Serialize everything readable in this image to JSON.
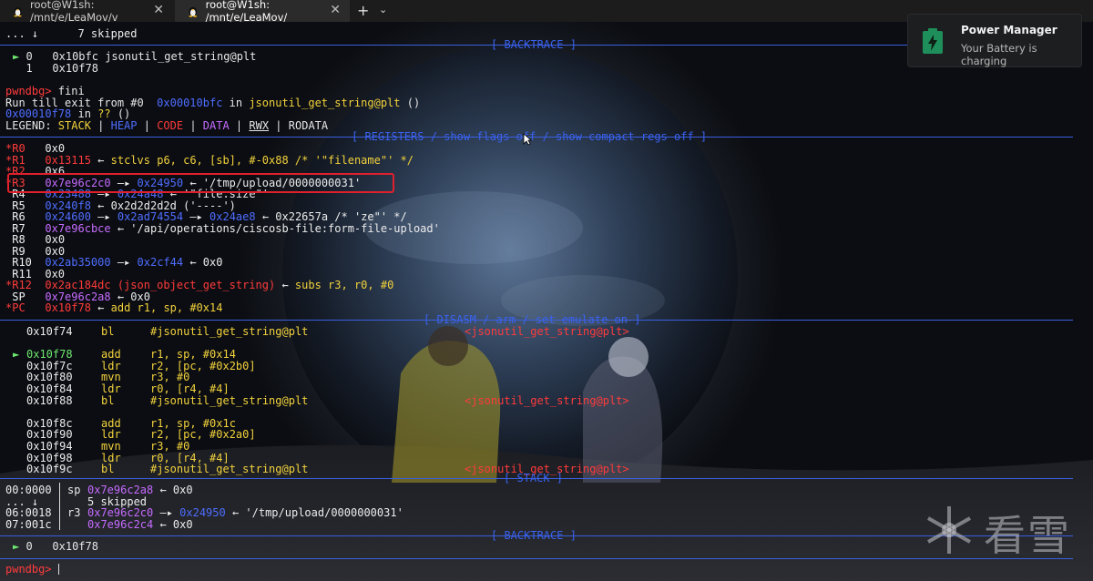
{
  "tabs": [
    {
      "title": "root@W1sh: /mnt/e/LeaMov/v",
      "close": "✕"
    },
    {
      "title": "root@W1sh: /mnt/e/LeaMov/",
      "close": "✕"
    }
  ],
  "tab_add": "+",
  "tab_dropdown": "⌄",
  "notification": {
    "title": "Power Manager",
    "message": "Your Battery is charging"
  },
  "sections": {
    "backtrace": "[ BACKTRACE ]",
    "registers": "[ REGISTERS / show-flags off / show-compact-regs off ]",
    "disasm": "[ DISASM / arm / set emulate on ]",
    "stack": "[ STACK ]",
    "backtrace2": "[ BACKTRACE ]"
  },
  "top": {
    "skipped_prefix": "... ↓",
    "skipped": "7 skipped",
    "bt0_marker": "►",
    "bt0_idx": "0",
    "bt0_addr": "0x10bfc",
    "bt0_sym": "jsonutil_get_string@plt",
    "bt1_idx": "1",
    "bt1_addr": "0x10f78"
  },
  "cmd": {
    "prompt": "pwndbg>",
    "command": " fini",
    "run1": "Run till exit from #0  ",
    "run_addr": "0x00010bfc",
    "run_in": " in ",
    "run_sym": "jsonutil_get_string@plt",
    "run_end": " ()",
    "ret_addr": "0x00010f78",
    "ret_in": " in ",
    "ret_sym": "??",
    "ret_end": " ()"
  },
  "legend": {
    "label": "LEGEND: ",
    "stack": "STACK",
    "heap": "HEAP",
    "code": "CODE",
    "data": "DATA",
    "rwx": "RWX",
    "rodata": "RODATA",
    "sep": " | "
  },
  "registers": [
    {
      "name": "*R0",
      "parts": [
        [
          "c-white",
          "0x0"
        ]
      ]
    },
    {
      "name": "*R1",
      "parts": [
        [
          "c-red",
          "0x13115"
        ],
        [
          "c-white",
          " ← "
        ],
        [
          "c-yellow",
          "stclvs p6, c6, [sb], #-0x88 /* '\"filename\"' */"
        ]
      ]
    },
    {
      "name": "*R2",
      "parts": [
        [
          "c-white",
          "0x6"
        ]
      ]
    },
    {
      "name": "*R3",
      "parts": [
        [
          "c-purple",
          "0x7e96c2c0"
        ],
        [
          "c-white",
          " —▸ "
        ],
        [
          "c-blue",
          "0x24950"
        ],
        [
          "c-white",
          " ← '/tmp/upload/0000000031'"
        ]
      ]
    },
    {
      "name": " R4",
      "parts": [
        [
          "c-blue",
          "0x23488"
        ],
        [
          "c-white",
          " —▸ "
        ],
        [
          "c-blue",
          "0x24a48"
        ],
        [
          "c-white",
          " ← '\"file.size\"'"
        ]
      ]
    },
    {
      "name": " R5",
      "parts": [
        [
          "c-blue",
          "0x240f8"
        ],
        [
          "c-white",
          " ← 0x2d2d2d2d ('----')"
        ]
      ]
    },
    {
      "name": " R6",
      "parts": [
        [
          "c-blue",
          "0x24600"
        ],
        [
          "c-white",
          " —▸ "
        ],
        [
          "c-blue",
          "0x2ad74554"
        ],
        [
          "c-white",
          " —▸ "
        ],
        [
          "c-blue",
          "0x24ae8"
        ],
        [
          "c-white",
          " ← 0x22657a /* 'ze\"' */"
        ]
      ]
    },
    {
      "name": " R7",
      "parts": [
        [
          "c-purple",
          "0x7e96cbce"
        ],
        [
          "c-white",
          " ← '/api/operations/ciscosb-file:form-file-upload'"
        ]
      ]
    },
    {
      "name": " R8",
      "parts": [
        [
          "c-white",
          "0x0"
        ]
      ]
    },
    {
      "name": " R9",
      "parts": [
        [
          "c-white",
          "0x0"
        ]
      ]
    },
    {
      "name": " R10",
      "parts": [
        [
          "c-blue",
          "0x2ab35000"
        ],
        [
          "c-white",
          " —▸ "
        ],
        [
          "c-blue",
          "0x2cf44"
        ],
        [
          "c-white",
          " ← 0x0"
        ]
      ]
    },
    {
      "name": " R11",
      "parts": [
        [
          "c-white",
          "0x0"
        ]
      ]
    },
    {
      "name": "*R12",
      "parts": [
        [
          "c-red",
          "0x2ac184dc (json_object_get_string)"
        ],
        [
          "c-white",
          " ← "
        ],
        [
          "c-yellow",
          "subs r3, r0, #0"
        ]
      ]
    },
    {
      "name": " SP",
      "parts": [
        [
          "c-purple",
          "0x7e96c2a8"
        ],
        [
          "c-white",
          " ← 0x0"
        ]
      ]
    },
    {
      "name": "*PC",
      "parts": [
        [
          "c-red",
          "0x10f78"
        ],
        [
          "c-white",
          " ← "
        ],
        [
          "c-yellow",
          "add r1, sp, #0x14"
        ]
      ]
    }
  ],
  "disasm": [
    {
      "marker": "",
      "addr": "0x10f74",
      "op": "bl",
      "args": "#jsonutil_get_string@plt",
      "target": "<jsonutil_get_string@plt>",
      "blank": false
    },
    {
      "marker": "",
      "addr": "",
      "op": "",
      "args": "",
      "target": "",
      "blank": true
    },
    {
      "marker": "►",
      "addr": "0x10f78",
      "op": "add",
      "args": "r1, sp, #0x14",
      "target": "",
      "blank": false
    },
    {
      "marker": "",
      "addr": "0x10f7c",
      "op": "ldr",
      "args": "r2, [pc, #0x2b0]",
      "target": "",
      "blank": false
    },
    {
      "marker": "",
      "addr": "0x10f80",
      "op": "mvn",
      "args": "r3, #0",
      "target": "",
      "blank": false
    },
    {
      "marker": "",
      "addr": "0x10f84",
      "op": "ldr",
      "args": "r0, [r4, #4]",
      "target": "",
      "blank": false
    },
    {
      "marker": "",
      "addr": "0x10f88",
      "op": "bl",
      "args": "#jsonutil_get_string@plt",
      "target": "<jsonutil_get_string@plt>",
      "blank": false
    },
    {
      "marker": "",
      "addr": "",
      "op": "",
      "args": "",
      "target": "",
      "blank": true
    },
    {
      "marker": "",
      "addr": "0x10f8c",
      "op": "add",
      "args": "r1, sp, #0x1c",
      "target": "",
      "blank": false
    },
    {
      "marker": "",
      "addr": "0x10f90",
      "op": "ldr",
      "args": "r2, [pc, #0x2a0]",
      "target": "",
      "blank": false
    },
    {
      "marker": "",
      "addr": "0x10f94",
      "op": "mvn",
      "args": "r3, #0",
      "target": "",
      "blank": false
    },
    {
      "marker": "",
      "addr": "0x10f98",
      "op": "ldr",
      "args": "r0, [r4, #4]",
      "target": "",
      "blank": false
    },
    {
      "marker": "",
      "addr": "0x10f9c",
      "op": "bl",
      "args": "#jsonutil_get_string@plt",
      "target": "<jsonutil_get_string@plt>",
      "blank": false
    }
  ],
  "stack": [
    {
      "off": "00:0000",
      "reg": "sp",
      "parts": [
        [
          "c-purple",
          "0x7e96c2a8"
        ],
        [
          "c-white",
          " ← 0x0"
        ]
      ]
    },
    {
      "off": "... ↓",
      "reg": "",
      "parts": [
        [
          "c-white",
          "5 skipped"
        ]
      ]
    },
    {
      "off": "06:0018",
      "reg": "r3",
      "parts": [
        [
          "c-purple",
          "0x7e96c2c0"
        ],
        [
          "c-white",
          " —▸ "
        ],
        [
          "c-blue",
          "0x24950"
        ],
        [
          "c-white",
          " ← '/tmp/upload/0000000031'"
        ]
      ]
    },
    {
      "off": "07:001c",
      "reg": "",
      "parts": [
        [
          "c-purple",
          "0x7e96c2c4"
        ],
        [
          "c-white",
          " ← 0x0"
        ]
      ]
    }
  ],
  "bottom_bt": {
    "marker": "►",
    "idx": "0",
    "addr": "0x10f78"
  },
  "final_prompt": "pwndbg>",
  "watermark": "看雪",
  "colors": {
    "accent": "#3a5fe0",
    "highlight": "#e0202c",
    "terminal_bg": "#0b0d12"
  }
}
